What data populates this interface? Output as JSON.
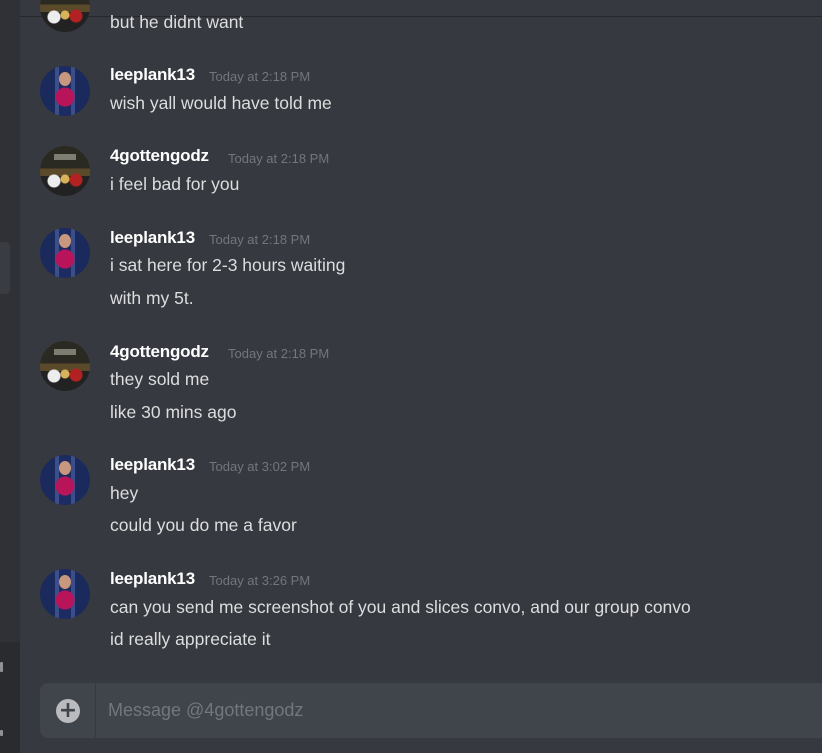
{
  "messages": [
    {
      "author": "",
      "timestamp": "",
      "lines": [
        "but he didnt want"
      ],
      "avatar": "godz-avatar"
    },
    {
      "author": "leeplank13",
      "timestamp": "Today at 2:18 PM",
      "lines": [
        "wish yall would have told me"
      ],
      "avatar": "leeplank-avatar"
    },
    {
      "author": "4gottengodz",
      "timestamp": "Today at 2:18 PM",
      "lines": [
        "i feel bad for you"
      ],
      "avatar": "godz-avatar"
    },
    {
      "author": "leeplank13",
      "timestamp": "Today at 2:18 PM",
      "lines": [
        "i sat here for 2-3 hours waiting",
        "with my 5t."
      ],
      "avatar": "leeplank-avatar"
    },
    {
      "author": "4gottengodz",
      "timestamp": "Today at 2:18 PM",
      "lines": [
        "they sold me",
        "like 30 mins ago"
      ],
      "avatar": "godz-avatar"
    },
    {
      "author": "leeplank13",
      "timestamp": "Today at 3:02 PM",
      "lines": [
        "hey",
        "could you do me a favor"
      ],
      "avatar": "leeplank-avatar"
    },
    {
      "author": "leeplank13",
      "timestamp": "Today at 3:26 PM",
      "lines": [
        "can you send me screenshot of you and slices convo, and our group convo",
        "id really appreciate it"
      ],
      "avatar": "leeplank-avatar"
    }
  ],
  "composer": {
    "placeholder": "Message @4gottengodz",
    "add_icon": "plus-circle-icon"
  },
  "colors": {
    "background": "#36393f",
    "input_background": "#40444b",
    "username": "#ffffff",
    "timestamp": "#72767d",
    "text": "#dcddde"
  }
}
